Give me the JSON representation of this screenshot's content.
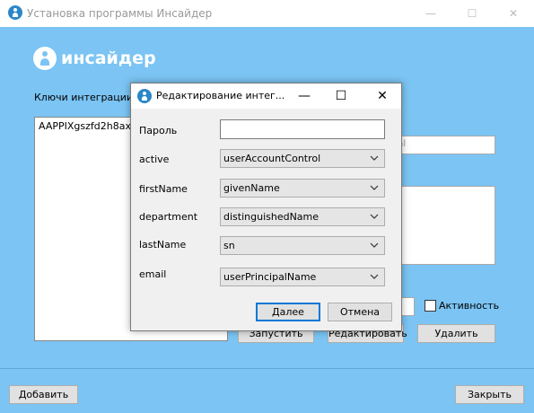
{
  "window": {
    "title": "Установка программы Инсайдер",
    "minimize": "—",
    "maximize": "☐",
    "close": "✕"
  },
  "logo": {
    "text": "инсайдер"
  },
  "keys": {
    "label": "Ключи интеграции",
    "items": [
      "AAPPIXgszfd2h8axxS"
    ]
  },
  "background": {
    "field1_placeholder": "ical",
    "active_checkbox_label": "Активность",
    "buttons": {
      "run": "Запустить",
      "edit": "Редактировать",
      "delete": "Удалить"
    }
  },
  "footer": {
    "add": "Добавить",
    "close": "Закрыть"
  },
  "dialog": {
    "title": "Редактирование интег...",
    "minimize": "—",
    "maximize": "☐",
    "close": "✕",
    "password_label": "Пароль",
    "password_value": "",
    "fields": [
      {
        "label": "active",
        "value": "userAccountControl"
      },
      {
        "label": "firstName",
        "value": "givenName"
      },
      {
        "label": "department",
        "value": "distinguishedName"
      },
      {
        "label": "lastName",
        "value": "sn"
      },
      {
        "label": "email",
        "value": "userPrincipalName"
      }
    ],
    "ok": "Далее",
    "cancel": "Отмена"
  },
  "colors": {
    "main_bg": "#7bc4f3",
    "accent": "#0078d7",
    "icon": "#2b87c8"
  }
}
